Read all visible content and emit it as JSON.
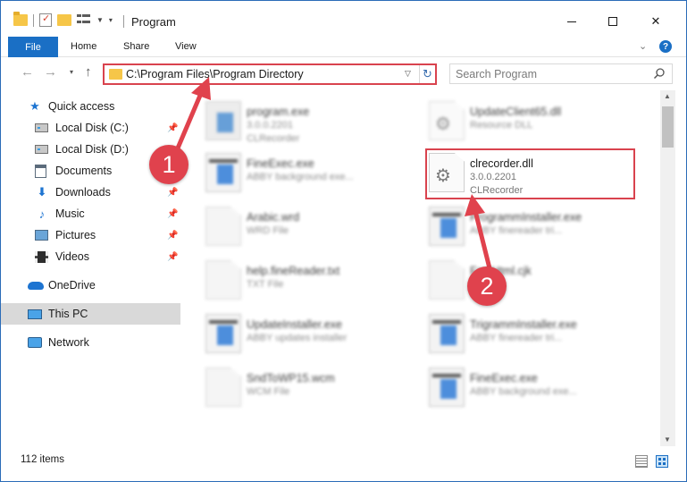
{
  "window": {
    "title": "Program",
    "minimize_icon": "minimize-icon",
    "maximize_icon": "maximize-icon",
    "close_icon": "close-icon"
  },
  "ribbon": {
    "tabs": [
      {
        "label": "File"
      },
      {
        "label": "Home"
      },
      {
        "label": "Share"
      },
      {
        "label": "View"
      }
    ],
    "file_tab_color": "#1a6fc5"
  },
  "navigation": {
    "address": "C:\\Program Files\\Program Directory",
    "search_placeholder": "Search Program"
  },
  "sidebar": {
    "items": [
      {
        "label": "Quick access",
        "icon": "star-icon",
        "pinned": false
      },
      {
        "label": "Local Disk (C:)",
        "icon": "disk-icon",
        "pinned": true
      },
      {
        "label": "Local Disk (D:)",
        "icon": "disk-icon",
        "pinned": false
      },
      {
        "label": "Documents",
        "icon": "documents-icon",
        "pinned": true
      },
      {
        "label": "Downloads",
        "icon": "download-icon",
        "pinned": true
      },
      {
        "label": "Music",
        "icon": "music-icon",
        "pinned": true
      },
      {
        "label": "Pictures",
        "icon": "pictures-icon",
        "pinned": true
      },
      {
        "label": "Videos",
        "icon": "videos-icon",
        "pinned": true
      },
      {
        "label": "OneDrive",
        "icon": "onedrive-icon",
        "pinned": false
      },
      {
        "label": "This PC",
        "icon": "pc-icon",
        "pinned": false,
        "selected": true
      },
      {
        "label": "Network",
        "icon": "network-icon",
        "pinned": false
      }
    ]
  },
  "files": [
    {
      "name": "program.exe",
      "line2": "3.0.0.2201",
      "line3": "CLRecorder",
      "icon": "exe-icon",
      "blurred": true
    },
    {
      "name": "UpdateClient65.dll",
      "line2": "Resource DLL",
      "line3": "",
      "icon": "dll-icon",
      "blurred": true
    },
    {
      "name": "FineExec.exe",
      "line2": "ABBY background exe...",
      "line3": "",
      "icon": "app-icon",
      "blurred": true
    },
    {
      "name": "clrecorder.dll",
      "line2": "3.0.0.2201",
      "line3": "CLRecorder",
      "icon": "gear-document-icon",
      "blurred": false
    },
    {
      "name": "Arabic.wrd",
      "line2": "WRD File",
      "line3": "",
      "icon": "document-icon",
      "blurred": true
    },
    {
      "name": "ProgrammInstaller.exe",
      "line2": "ABBY finereader tri...",
      "line3": "",
      "icon": "app-icon",
      "blurred": true
    },
    {
      "name": "help.fineReader.txt",
      "line2": "TXT File",
      "line3": "",
      "icon": "document-icon",
      "blurred": true
    },
    {
      "name": "FastHtml.cjk",
      "line2": "",
      "line3": "",
      "icon": "document-icon",
      "blurred": true
    },
    {
      "name": "UpdateInstaller.exe",
      "line2": "ABBY updates installer",
      "line3": "",
      "icon": "app-icon",
      "blurred": true
    },
    {
      "name": "TrigrammInstaller.exe",
      "line2": "ABBY finereader tri...",
      "line3": "",
      "icon": "app-icon",
      "blurred": true
    },
    {
      "name": "SndToWP15.wcm",
      "line2": "WCM File",
      "line3": "",
      "icon": "document-icon",
      "blurred": true
    },
    {
      "name": "FineExec.exe",
      "line2": "ABBY background exe...",
      "line3": "",
      "icon": "app-icon",
      "blurred": true
    }
  ],
  "status": {
    "item_count": "112 items"
  },
  "callouts": [
    {
      "number": "1",
      "target": "address-bar"
    },
    {
      "number": "2",
      "target": "clrecorder.dll"
    }
  ],
  "colors": {
    "callout_red": "#e0424d",
    "highlight_red": "#d9434e",
    "accent_blue": "#1a6fc5"
  }
}
